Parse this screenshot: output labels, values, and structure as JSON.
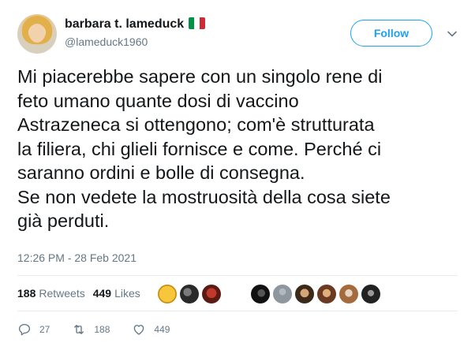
{
  "author": {
    "display_name": "barbara t. lameduck",
    "handle": "@lameduck1960",
    "flag": "italy-flag"
  },
  "follow_label": "Follow",
  "tweet_text": "Mi piacerebbe sapere con un singolo rene di\nfeto umano quante dosi di vaccino\nAstrazeneca si ottengono; com'è strutturata\nla filiera, chi glieli fornisce e come. Perché ci\nsaranno ordini e bolle di consegna.\nSe non vedete la mostruosità della cosa siete\ngià perduti.",
  "timestamp": "12:26 PM - 28 Feb 2021",
  "stats": {
    "retweets_count": "188",
    "retweets_label": "Retweets",
    "likes_count": "449",
    "likes_label": "Likes"
  },
  "actions": {
    "reply_count": "27",
    "retweet_count": "188",
    "like_count": "449"
  },
  "colors": {
    "accent": "#1da1f2",
    "secondary_text": "#657786",
    "primary_text": "#14171a",
    "divider": "#e6ecf0",
    "flag_green": "#009246",
    "flag_white": "#ffffff",
    "flag_red": "#ce2b37"
  }
}
